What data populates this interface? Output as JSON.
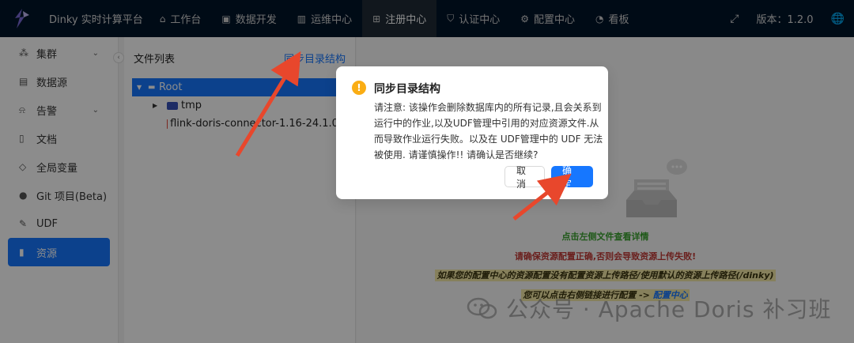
{
  "app": {
    "title": "Dinky 实时计算平台",
    "version_label": "版本：1.2.0"
  },
  "nav": {
    "items": [
      {
        "label": "工作台",
        "icon": "home-icon"
      },
      {
        "label": "数据开发",
        "icon": "terminal-icon"
      },
      {
        "label": "运维中心",
        "icon": "chart-icon"
      },
      {
        "label": "注册中心",
        "icon": "grid-icon"
      },
      {
        "label": "认证中心",
        "icon": "shield-icon"
      },
      {
        "label": "配置中心",
        "icon": "gear-icon"
      },
      {
        "label": "看板",
        "icon": "dashboard-icon"
      }
    ],
    "active_index": 3
  },
  "sidebar": {
    "items": [
      {
        "label": "集群",
        "icon": "cluster-icon",
        "has_children": true
      },
      {
        "label": "数据源",
        "icon": "database-icon",
        "has_children": false
      },
      {
        "label": "告警",
        "icon": "alarm-icon",
        "has_children": true
      },
      {
        "label": "文档",
        "icon": "document-icon",
        "has_children": false
      },
      {
        "label": "全局变量",
        "icon": "variable-icon",
        "has_children": false
      },
      {
        "label": "Git 项目(Beta)",
        "icon": "github-icon",
        "has_children": false
      },
      {
        "label": "UDF",
        "icon": "tool-icon",
        "has_children": false
      },
      {
        "label": "资源",
        "icon": "file-icon",
        "has_children": false
      }
    ],
    "active_index": 7
  },
  "file_tree": {
    "title": "文件列表",
    "sync_link": "同步目录结构",
    "root_label": "Root",
    "children": [
      {
        "label": "tmp",
        "type": "folder"
      },
      {
        "label": "flink-doris-connector-1.16-24.1.0.jar",
        "type": "file"
      }
    ]
  },
  "main": {
    "hint_green": "点击左侧文件查看详情",
    "hint_red": "请确保资源配置正确,否则会导致资源上传失败!",
    "hint_yellow": "如果您的配置中心的资源配置没有配置资源上传路径/使用默认的资源上传路径(/dinky)",
    "hint_link_prefix": "您可以点击右侧链接进行配置 ->",
    "hint_link_text": "配置中心"
  },
  "modal": {
    "title": "同步目录结构",
    "body": "请注意: 该操作会删除数据库内的所有记录,且会关系到运行中的作业,以及UDF管理中引用的对应资源文件.从而导致作业运行失败。以及在 UDF管理中的 UDF 无法被使用. 请谨慎操作!! 请确认是否继续?",
    "cancel_label": "取 消",
    "ok_label": "确 定"
  },
  "watermark": {
    "text": "公众号 · Apache Doris 补习班"
  },
  "colors": {
    "topbar": "#001529",
    "primary": "#1677ff",
    "warning": "#faad14",
    "arrow": "#e8472c"
  }
}
